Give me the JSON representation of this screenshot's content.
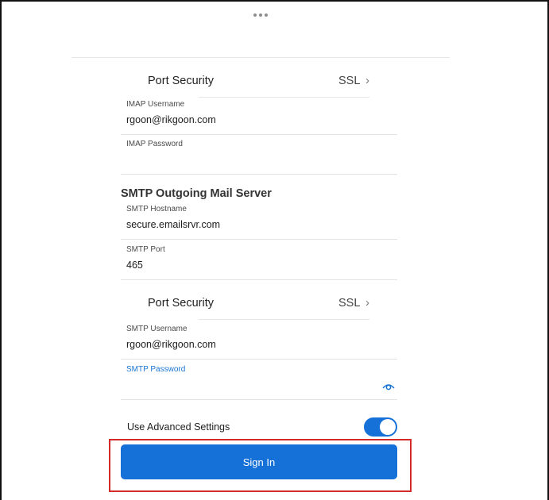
{
  "imap": {
    "port_security": {
      "label": "Port Security",
      "value": "SSL",
      "chevron": "›"
    },
    "username": {
      "label": "IMAP Username",
      "value": "rgoon@rikgoon.com"
    },
    "password": {
      "label": "IMAP Password",
      "value": ""
    }
  },
  "smtp": {
    "section_title": "SMTP Outgoing Mail Server",
    "hostname": {
      "label": "SMTP Hostname",
      "value": "secure.emailsrvr.com"
    },
    "port": {
      "label": "SMTP Port",
      "value": "465"
    },
    "port_security": {
      "label": "Port Security",
      "value": "SSL",
      "chevron": "›"
    },
    "username": {
      "label": "SMTP Username",
      "value": "rgoon@rikgoon.com"
    },
    "password": {
      "label": "SMTP Password",
      "value": ""
    }
  },
  "advanced": {
    "label": "Use Advanced Settings",
    "enabled": true
  },
  "signin": {
    "label": "Sign In"
  },
  "colors": {
    "accent": "#1570d8",
    "highlight": "#d52a2a"
  },
  "icons": {
    "grabber": "more-dots-icon",
    "eye": "eye-icon",
    "chevron": "chevron-right-icon"
  }
}
